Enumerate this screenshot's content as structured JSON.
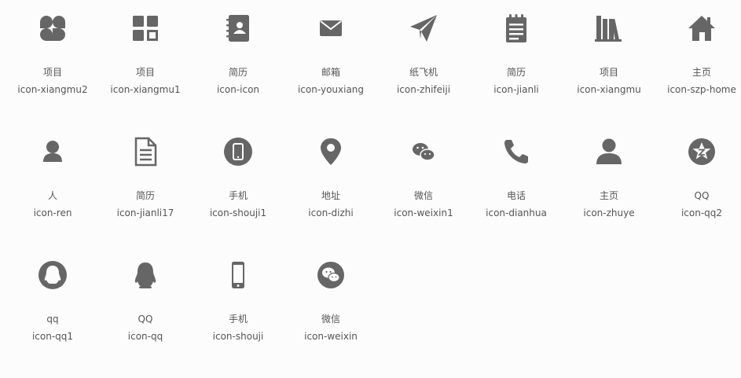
{
  "theme": {
    "icon_color": "#666666",
    "text_color": "#555555",
    "background": "#fcfcfc"
  },
  "icons": [
    {
      "label": "项目",
      "class_name": "icon-xiangmu2",
      "glyph": "four-petal-icon"
    },
    {
      "label": "项目",
      "class_name": "icon-xiangmu1",
      "glyph": "grid-squares-icon"
    },
    {
      "label": "简历",
      "class_name": "icon-icon",
      "glyph": "address-book-icon"
    },
    {
      "label": "邮箱",
      "class_name": "icon-youxiang",
      "glyph": "envelope-icon"
    },
    {
      "label": "纸飞机",
      "class_name": "icon-zhifeiji",
      "glyph": "paper-plane-icon"
    },
    {
      "label": "简历",
      "class_name": "icon-jianli",
      "glyph": "notepad-icon"
    },
    {
      "label": "项目",
      "class_name": "icon-xiangmu",
      "glyph": "books-icon"
    },
    {
      "label": "主页",
      "class_name": "icon-szp-home",
      "glyph": "house-icon"
    },
    {
      "label": "人",
      "class_name": "icon-ren",
      "glyph": "person-icon"
    },
    {
      "label": "简历",
      "class_name": "icon-jianli17",
      "glyph": "document-icon"
    },
    {
      "label": "手机",
      "class_name": "icon-shouji1",
      "glyph": "phone-circle-icon"
    },
    {
      "label": "地址",
      "class_name": "icon-dizhi",
      "glyph": "map-pin-icon"
    },
    {
      "label": "微信",
      "class_name": "icon-weixin1",
      "glyph": "wechat-icon"
    },
    {
      "label": "电话",
      "class_name": "icon-dianhua",
      "glyph": "telephone-icon"
    },
    {
      "label": "主页",
      "class_name": "icon-zhuye",
      "glyph": "user-icon"
    },
    {
      "label": "QQ",
      "class_name": "icon-qq2",
      "glyph": "star-circle-icon"
    },
    {
      "label": "qq",
      "class_name": "icon-qq1",
      "glyph": "qq-circle-icon"
    },
    {
      "label": "QQ",
      "class_name": "icon-qq",
      "glyph": "qq-penguin-icon"
    },
    {
      "label": "手机",
      "class_name": "icon-shouji",
      "glyph": "mobile-phone-icon"
    },
    {
      "label": "微信",
      "class_name": "icon-weixin",
      "glyph": "wechat-circle-icon"
    }
  ]
}
